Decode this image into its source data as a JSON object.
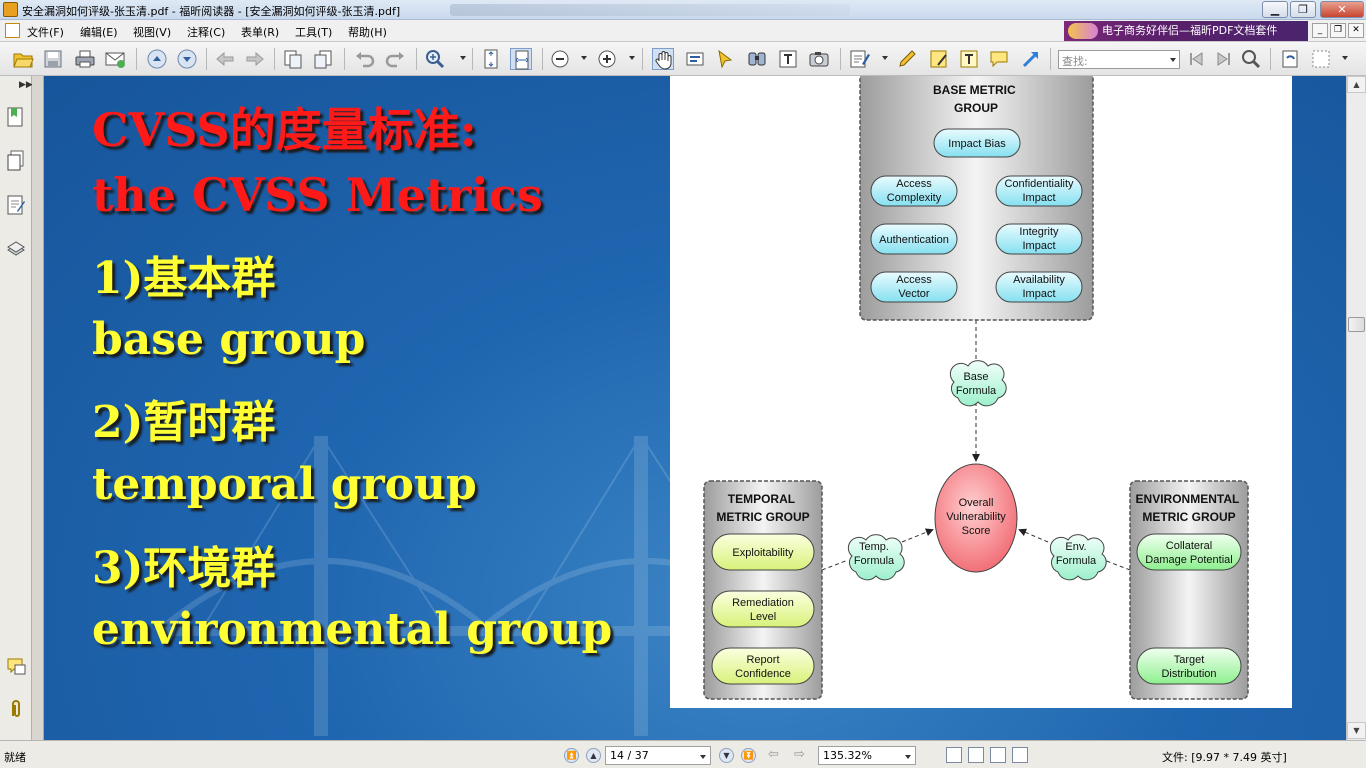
{
  "window": {
    "title": "安全漏洞如何评级-张玉清.pdf - 福昕阅读器 - [安全漏洞如何评级-张玉清.pdf]"
  },
  "menu": {
    "items": [
      "文件(F)",
      "编辑(E)",
      "视图(V)",
      "注释(C)",
      "表单(R)",
      "工具(T)",
      "帮助(H)"
    ],
    "promo": "电子商务好伴侣—福昕PDF文档套件"
  },
  "toolbar": {
    "search_placeholder": "查找:"
  },
  "slide": {
    "lines": [
      "CVSS的度量标准:",
      "the CVSS Metrics",
      "1)基本群",
      "base group",
      "2)暂时群",
      "temporal group",
      "3)环境群",
      "environmental group"
    ]
  },
  "diagram": {
    "base_group": {
      "title": [
        "BASE METRIC",
        "GROUP"
      ],
      "items": [
        [
          "Impact Bias"
        ],
        [
          "Access",
          "Complexity"
        ],
        [
          "Confidentiality",
          "Impact"
        ],
        [
          "Authentication"
        ],
        [
          "Integrity",
          "Impact"
        ],
        [
          "Access",
          "Vector"
        ],
        [
          "Availability",
          "Impact"
        ]
      ]
    },
    "base_formula": [
      "Base",
      "Formula"
    ],
    "score": [
      "Overall",
      "Vulnerability",
      "Score"
    ],
    "temporal_group": {
      "title": [
        "TEMPORAL",
        "METRIC GROUP"
      ],
      "items": [
        [
          "Exploitability"
        ],
        [
          "Remediation",
          "Level"
        ],
        [
          "Report",
          "Confidence"
        ]
      ]
    },
    "temp_formula": [
      "Temp.",
      "Formula"
    ],
    "environmental_group": {
      "title": [
        "ENVIRONMENTAL",
        "METRIC GROUP"
      ],
      "items": [
        [
          "Collateral",
          "Damage Potential"
        ],
        [
          "Target",
          "Distribution"
        ]
      ]
    },
    "env_formula": [
      "Env.",
      "Formula"
    ]
  },
  "status": {
    "text": "就绪",
    "page": "14 / 37",
    "zoom": "135.32%",
    "file_size": "文件: [9.97 * 7.49 英寸]"
  }
}
